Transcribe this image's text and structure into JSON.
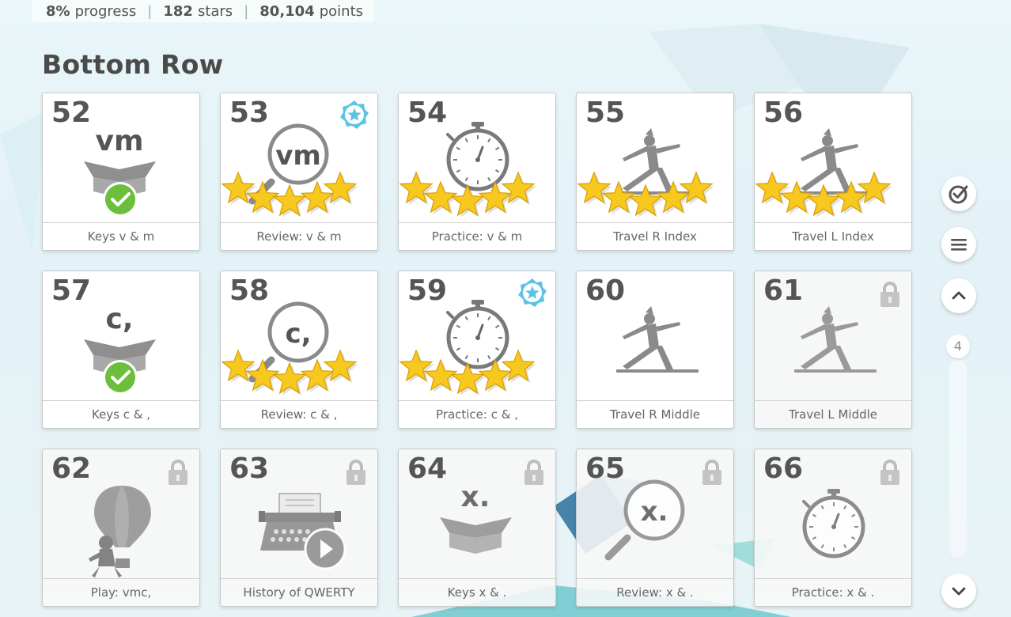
{
  "progress": {
    "percent_value": "8%",
    "percent_label": "progress",
    "stars_value": "182",
    "stars_label": "stars",
    "points_value": "80,104",
    "points_label": "points"
  },
  "section": {
    "title": "Bottom Row"
  },
  "lessons": [
    {
      "num": "52",
      "label": "Keys v & m",
      "kind": "keys",
      "text": "vm",
      "done": true,
      "stars": 0,
      "locked": false,
      "badge": false
    },
    {
      "num": "53",
      "label": "Review: v & m",
      "kind": "review",
      "text": "vm",
      "stars": 5,
      "locked": false,
      "badge": true
    },
    {
      "num": "54",
      "label": "Practice: v & m",
      "kind": "practice",
      "stars": 5,
      "locked": false,
      "badge": false
    },
    {
      "num": "55",
      "label": "Travel R Index",
      "kind": "travel",
      "stars": 5,
      "locked": false,
      "badge": false
    },
    {
      "num": "56",
      "label": "Travel L Index",
      "kind": "travel",
      "stars": 5,
      "locked": false,
      "badge": false
    },
    {
      "num": "57",
      "label": "Keys c & ,",
      "kind": "keys",
      "text": "c,",
      "done": true,
      "stars": 0,
      "locked": false,
      "badge": false
    },
    {
      "num": "58",
      "label": "Review: c & ,",
      "kind": "review",
      "text": "c,",
      "stars": 5,
      "locked": false,
      "badge": false
    },
    {
      "num": "59",
      "label": "Practice: c & ,",
      "kind": "practice",
      "stars": 5,
      "locked": false,
      "badge": true
    },
    {
      "num": "60",
      "label": "Travel R Middle",
      "kind": "travel",
      "stars": 0,
      "locked": false,
      "badge": false
    },
    {
      "num": "61",
      "label": "Travel L Middle",
      "kind": "travel",
      "stars": 0,
      "locked": true,
      "badge": false
    },
    {
      "num": "62",
      "label": "Play: vmc,",
      "kind": "play",
      "stars": 0,
      "locked": true,
      "badge": false
    },
    {
      "num": "63",
      "label": "History of QWERTY",
      "kind": "history",
      "stars": 0,
      "locked": true,
      "badge": false
    },
    {
      "num": "64",
      "label": "Keys x & .",
      "kind": "keys",
      "text": "x.",
      "done": false,
      "stars": 0,
      "locked": true,
      "badge": false
    },
    {
      "num": "65",
      "label": "Review: x & .",
      "kind": "review",
      "text": "x.",
      "stars": 0,
      "locked": true,
      "badge": false
    },
    {
      "num": "66",
      "label": "Practice: x & .",
      "kind": "practice",
      "stars": 0,
      "locked": true,
      "badge": false
    }
  ],
  "sidebar": {
    "page_number": "4"
  },
  "colors": {
    "star": "#f7c81e",
    "check": "#6cbf3a",
    "badge": "#5bc4e6",
    "icon_gray": "#8a8a8a"
  }
}
